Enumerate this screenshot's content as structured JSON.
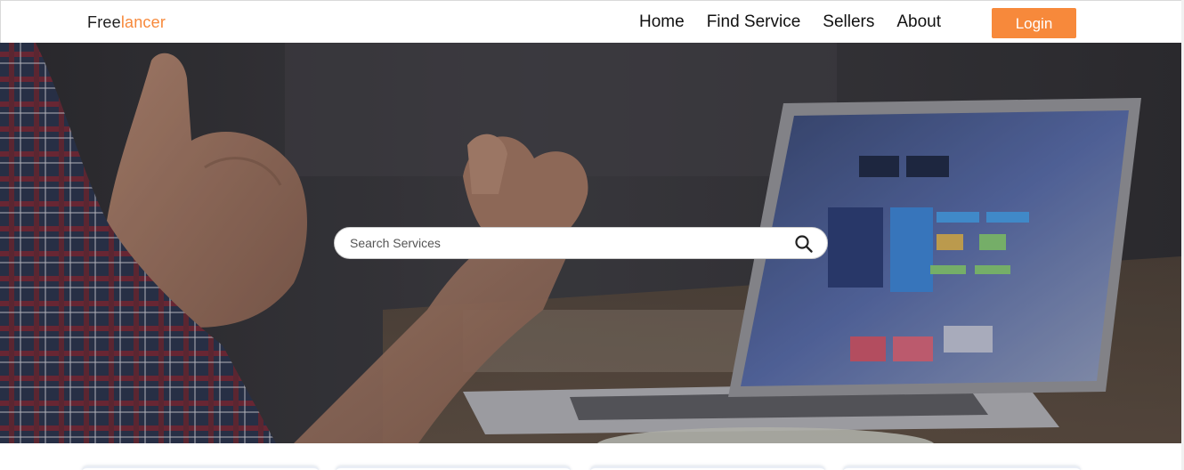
{
  "brand": {
    "prefix": "Free",
    "accent": "lancer",
    "accent_color": "#f7893b"
  },
  "nav": {
    "items": [
      {
        "label": "Home"
      },
      {
        "label": "Find Service"
      },
      {
        "label": "Sellers"
      },
      {
        "label": "About"
      }
    ],
    "login_label": "Login"
  },
  "hero": {
    "search": {
      "placeholder": "Search Services",
      "value": "",
      "icon": "search-icon"
    }
  },
  "colors": {
    "accent": "#f7893b",
    "header_bg": "#ffffff",
    "text": "#111111"
  }
}
